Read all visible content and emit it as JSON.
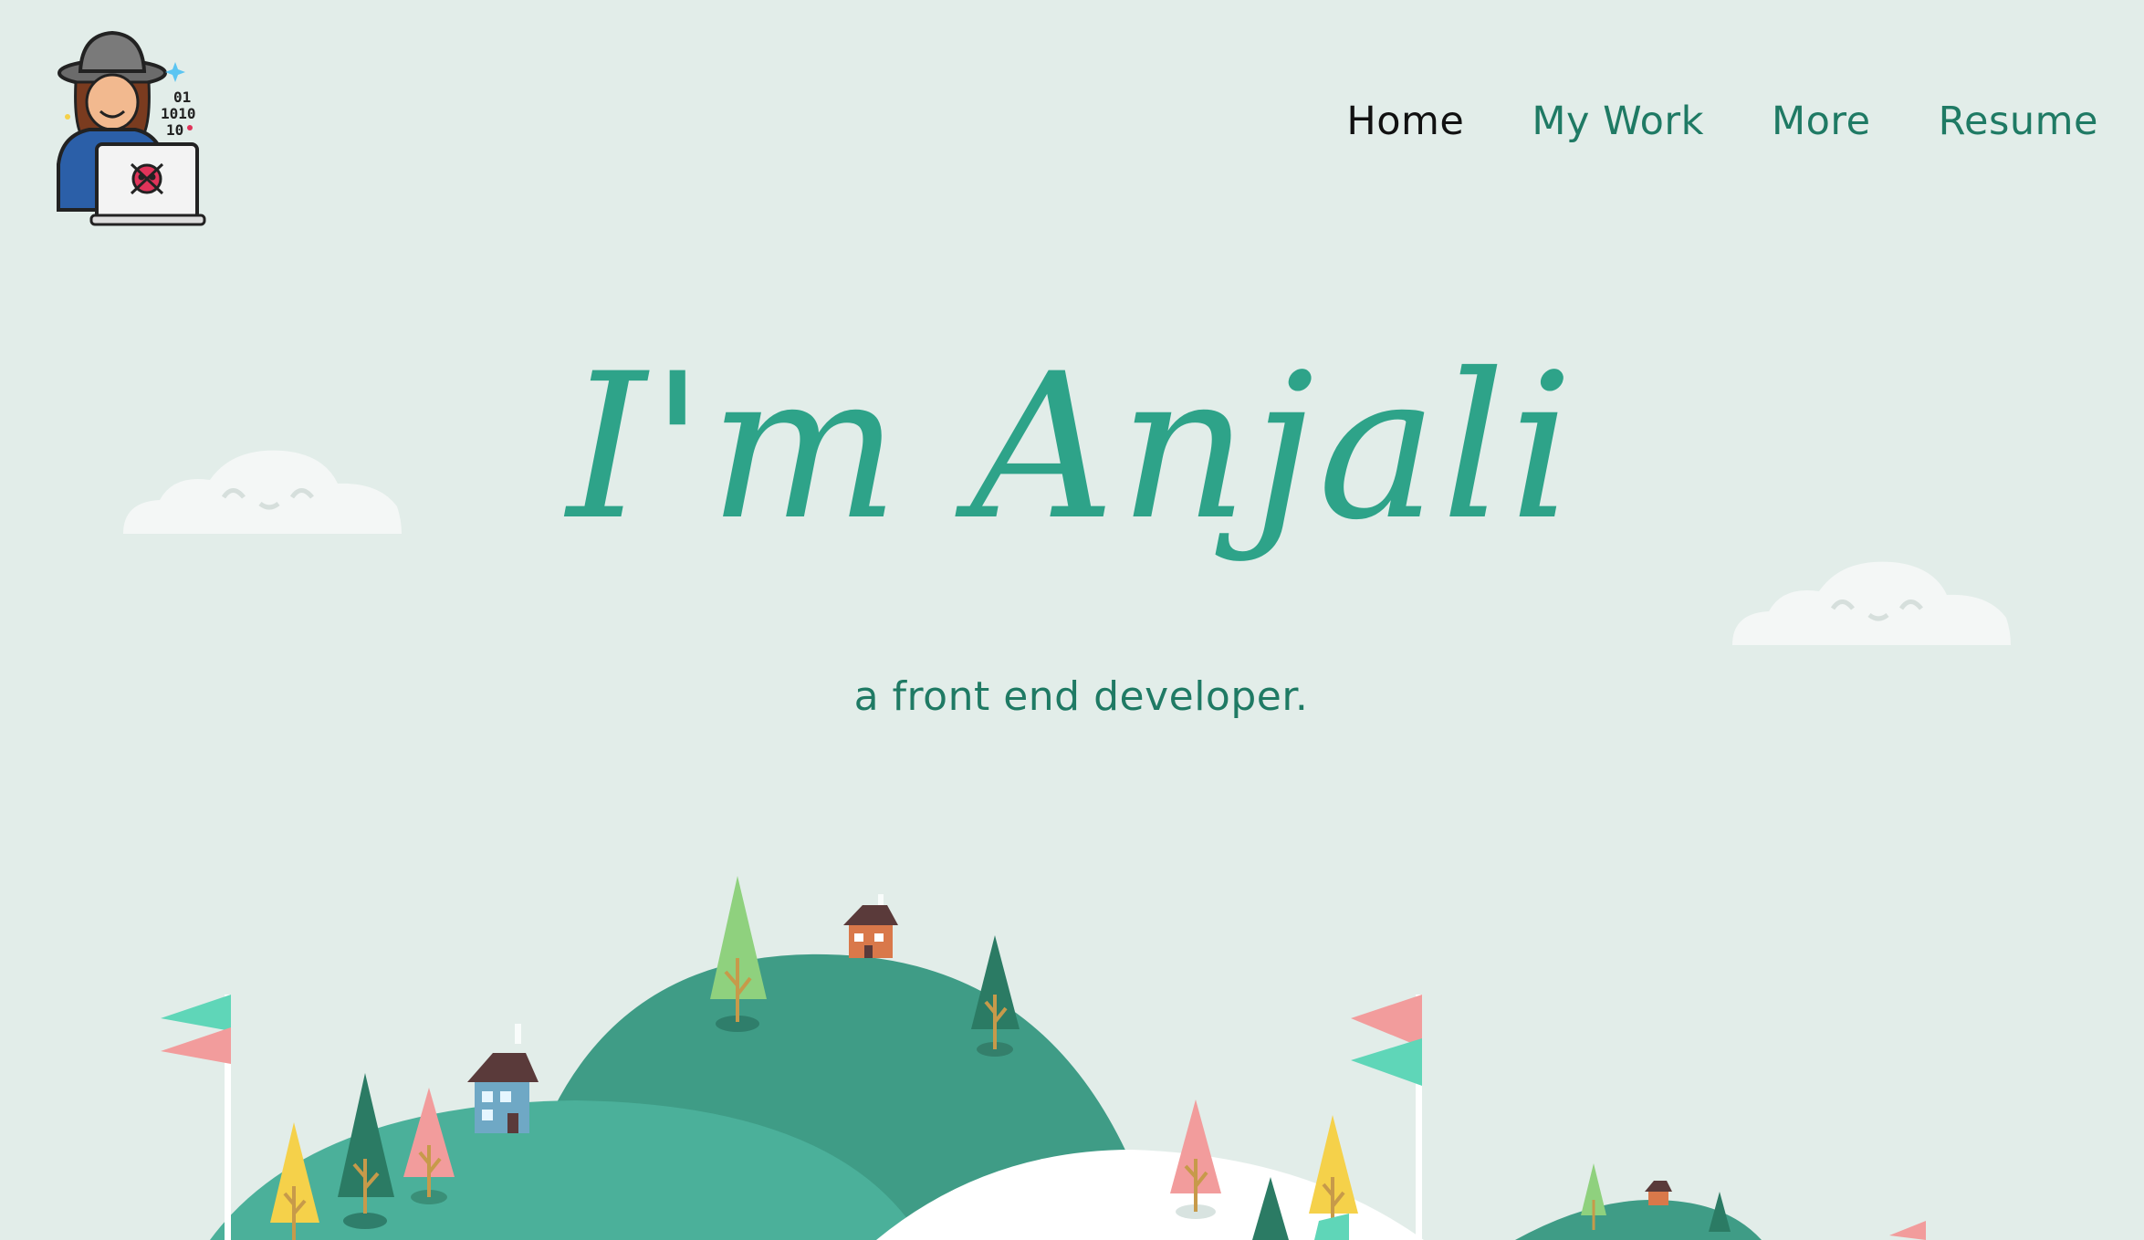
{
  "nav": {
    "items": [
      {
        "label": "Home",
        "active": true
      },
      {
        "label": "My Work",
        "active": false
      },
      {
        "label": "More",
        "active": false
      },
      {
        "label": "Resume",
        "active": false
      }
    ]
  },
  "hero": {
    "title": "I'm Anjali",
    "subtitle": "a front end developer."
  },
  "logo": {
    "binary_lines": [
      "01",
      "1010",
      "10"
    ]
  },
  "colors": {
    "background": "#e2ede9",
    "accent": "#2ea389",
    "nav_text": "#1f7a64",
    "active_nav": "#111111",
    "hill_dark": "#3f9c86",
    "hill_light": "#4bb09a",
    "pink": "#f29c9c",
    "mint": "#5fd6b8",
    "yellow": "#f5d14a"
  },
  "icons": {
    "logo": "hacker-avatar-icon",
    "cloud": "cloud-icon",
    "flag": "flag-icon",
    "tree": "tree-icon",
    "house": "house-icon"
  }
}
